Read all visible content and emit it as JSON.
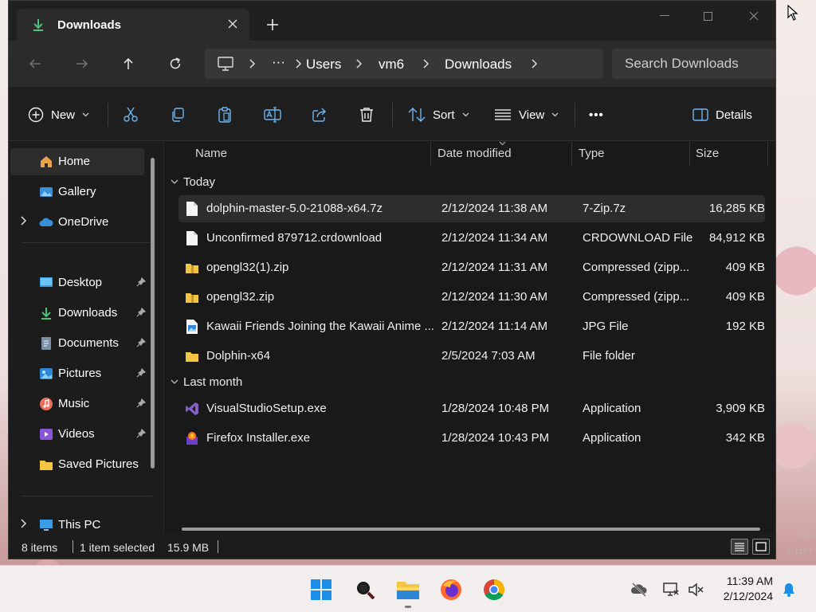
{
  "window": {
    "tab_title": "Downloads",
    "tab_icon": "download-arrow-icon",
    "close_tab_icon": "close-icon",
    "new_tab_icon": "plus-icon"
  },
  "nav": {
    "back_icon": "arrow-left-icon",
    "forward_icon": "arrow-right-icon",
    "up_icon": "arrow-up-icon",
    "refresh_icon": "refresh-icon",
    "breadcrumb": [
      "Users",
      "vm6",
      "Downloads"
    ],
    "more_crumbs": "···",
    "search_placeholder": "Search Downloads"
  },
  "toolbar": {
    "new_label": "New",
    "sort_label": "Sort",
    "view_label": "View",
    "more_label": "•••",
    "details_label": "Details"
  },
  "sidebar": {
    "items": [
      {
        "label": "Home",
        "icon": "home-icon",
        "active": true
      },
      {
        "label": "Gallery",
        "icon": "gallery-icon"
      },
      {
        "label": "OneDrive",
        "icon": "cloud-icon",
        "expandable": true
      },
      {
        "label": "Desktop",
        "icon": "desktop-icon",
        "pinned": true
      },
      {
        "label": "Downloads",
        "icon": "download-icon",
        "pinned": true
      },
      {
        "label": "Documents",
        "icon": "documents-icon",
        "pinned": true
      },
      {
        "label": "Pictures",
        "icon": "pictures-icon",
        "pinned": true
      },
      {
        "label": "Music",
        "icon": "music-icon",
        "pinned": true
      },
      {
        "label": "Videos",
        "icon": "videos-icon",
        "pinned": true
      },
      {
        "label": "Saved Pictures",
        "icon": "folder-icon"
      },
      {
        "label": "This PC",
        "icon": "pc-icon",
        "expandable": true
      }
    ]
  },
  "columns": {
    "name": "Name",
    "date": "Date modified",
    "type": "Type",
    "size": "Size"
  },
  "groups": [
    {
      "label": "Today",
      "files": [
        {
          "name": "dolphin-master-5.0-21088-x64.7z",
          "date": "2/12/2024 11:38 AM",
          "type": "7-Zip.7z",
          "size": "16,285 KB",
          "icon": "file-icon",
          "selected": true
        },
        {
          "name": "Unconfirmed 879712.crdownload",
          "date": "2/12/2024 11:34 AM",
          "type": "CRDOWNLOAD File",
          "size": "84,912 KB",
          "icon": "file-icon"
        },
        {
          "name": "opengl32(1).zip",
          "date": "2/12/2024 11:31 AM",
          "type": "Compressed (zipp...",
          "size": "409 KB",
          "icon": "zip-folder-icon"
        },
        {
          "name": "opengl32.zip",
          "date": "2/12/2024 11:30 AM",
          "type": "Compressed (zipp...",
          "size": "409 KB",
          "icon": "zip-folder-icon"
        },
        {
          "name": "Kawaii Friends Joining the Kawaii Anime ...",
          "date": "2/12/2024 11:14 AM",
          "type": "JPG File",
          "size": "192 KB",
          "icon": "image-file-icon"
        },
        {
          "name": "Dolphin-x64",
          "date": "2/5/2024 7:03 AM",
          "type": "File folder",
          "size": "",
          "icon": "folder-icon"
        }
      ]
    },
    {
      "label": "Last month",
      "files": [
        {
          "name": "VisualStudioSetup.exe",
          "date": "1/28/2024 10:48 PM",
          "type": "Application",
          "size": "3,909 KB",
          "icon": "visual-studio-icon"
        },
        {
          "name": "Firefox Installer.exe",
          "date": "1/28/2024 10:43 PM",
          "type": "Application",
          "size": "342 KB",
          "icon": "firefox-installer-icon"
        }
      ]
    }
  ],
  "status": {
    "item_count": "8 items",
    "selection": "1 item selected",
    "selection_size": "15.9 MB"
  },
  "taskbar": {
    "apps": [
      "windows-start-icon",
      "search-icon",
      "file-explorer-icon",
      "firefox-icon",
      "chrome-icon"
    ],
    "time": "11:39 AM",
    "date": "2/12/2024"
  },
  "colors": {
    "accent_blue": "#0078d4",
    "folder_yellow": "#f4c542",
    "window_bg": "#1c1c1c"
  }
}
